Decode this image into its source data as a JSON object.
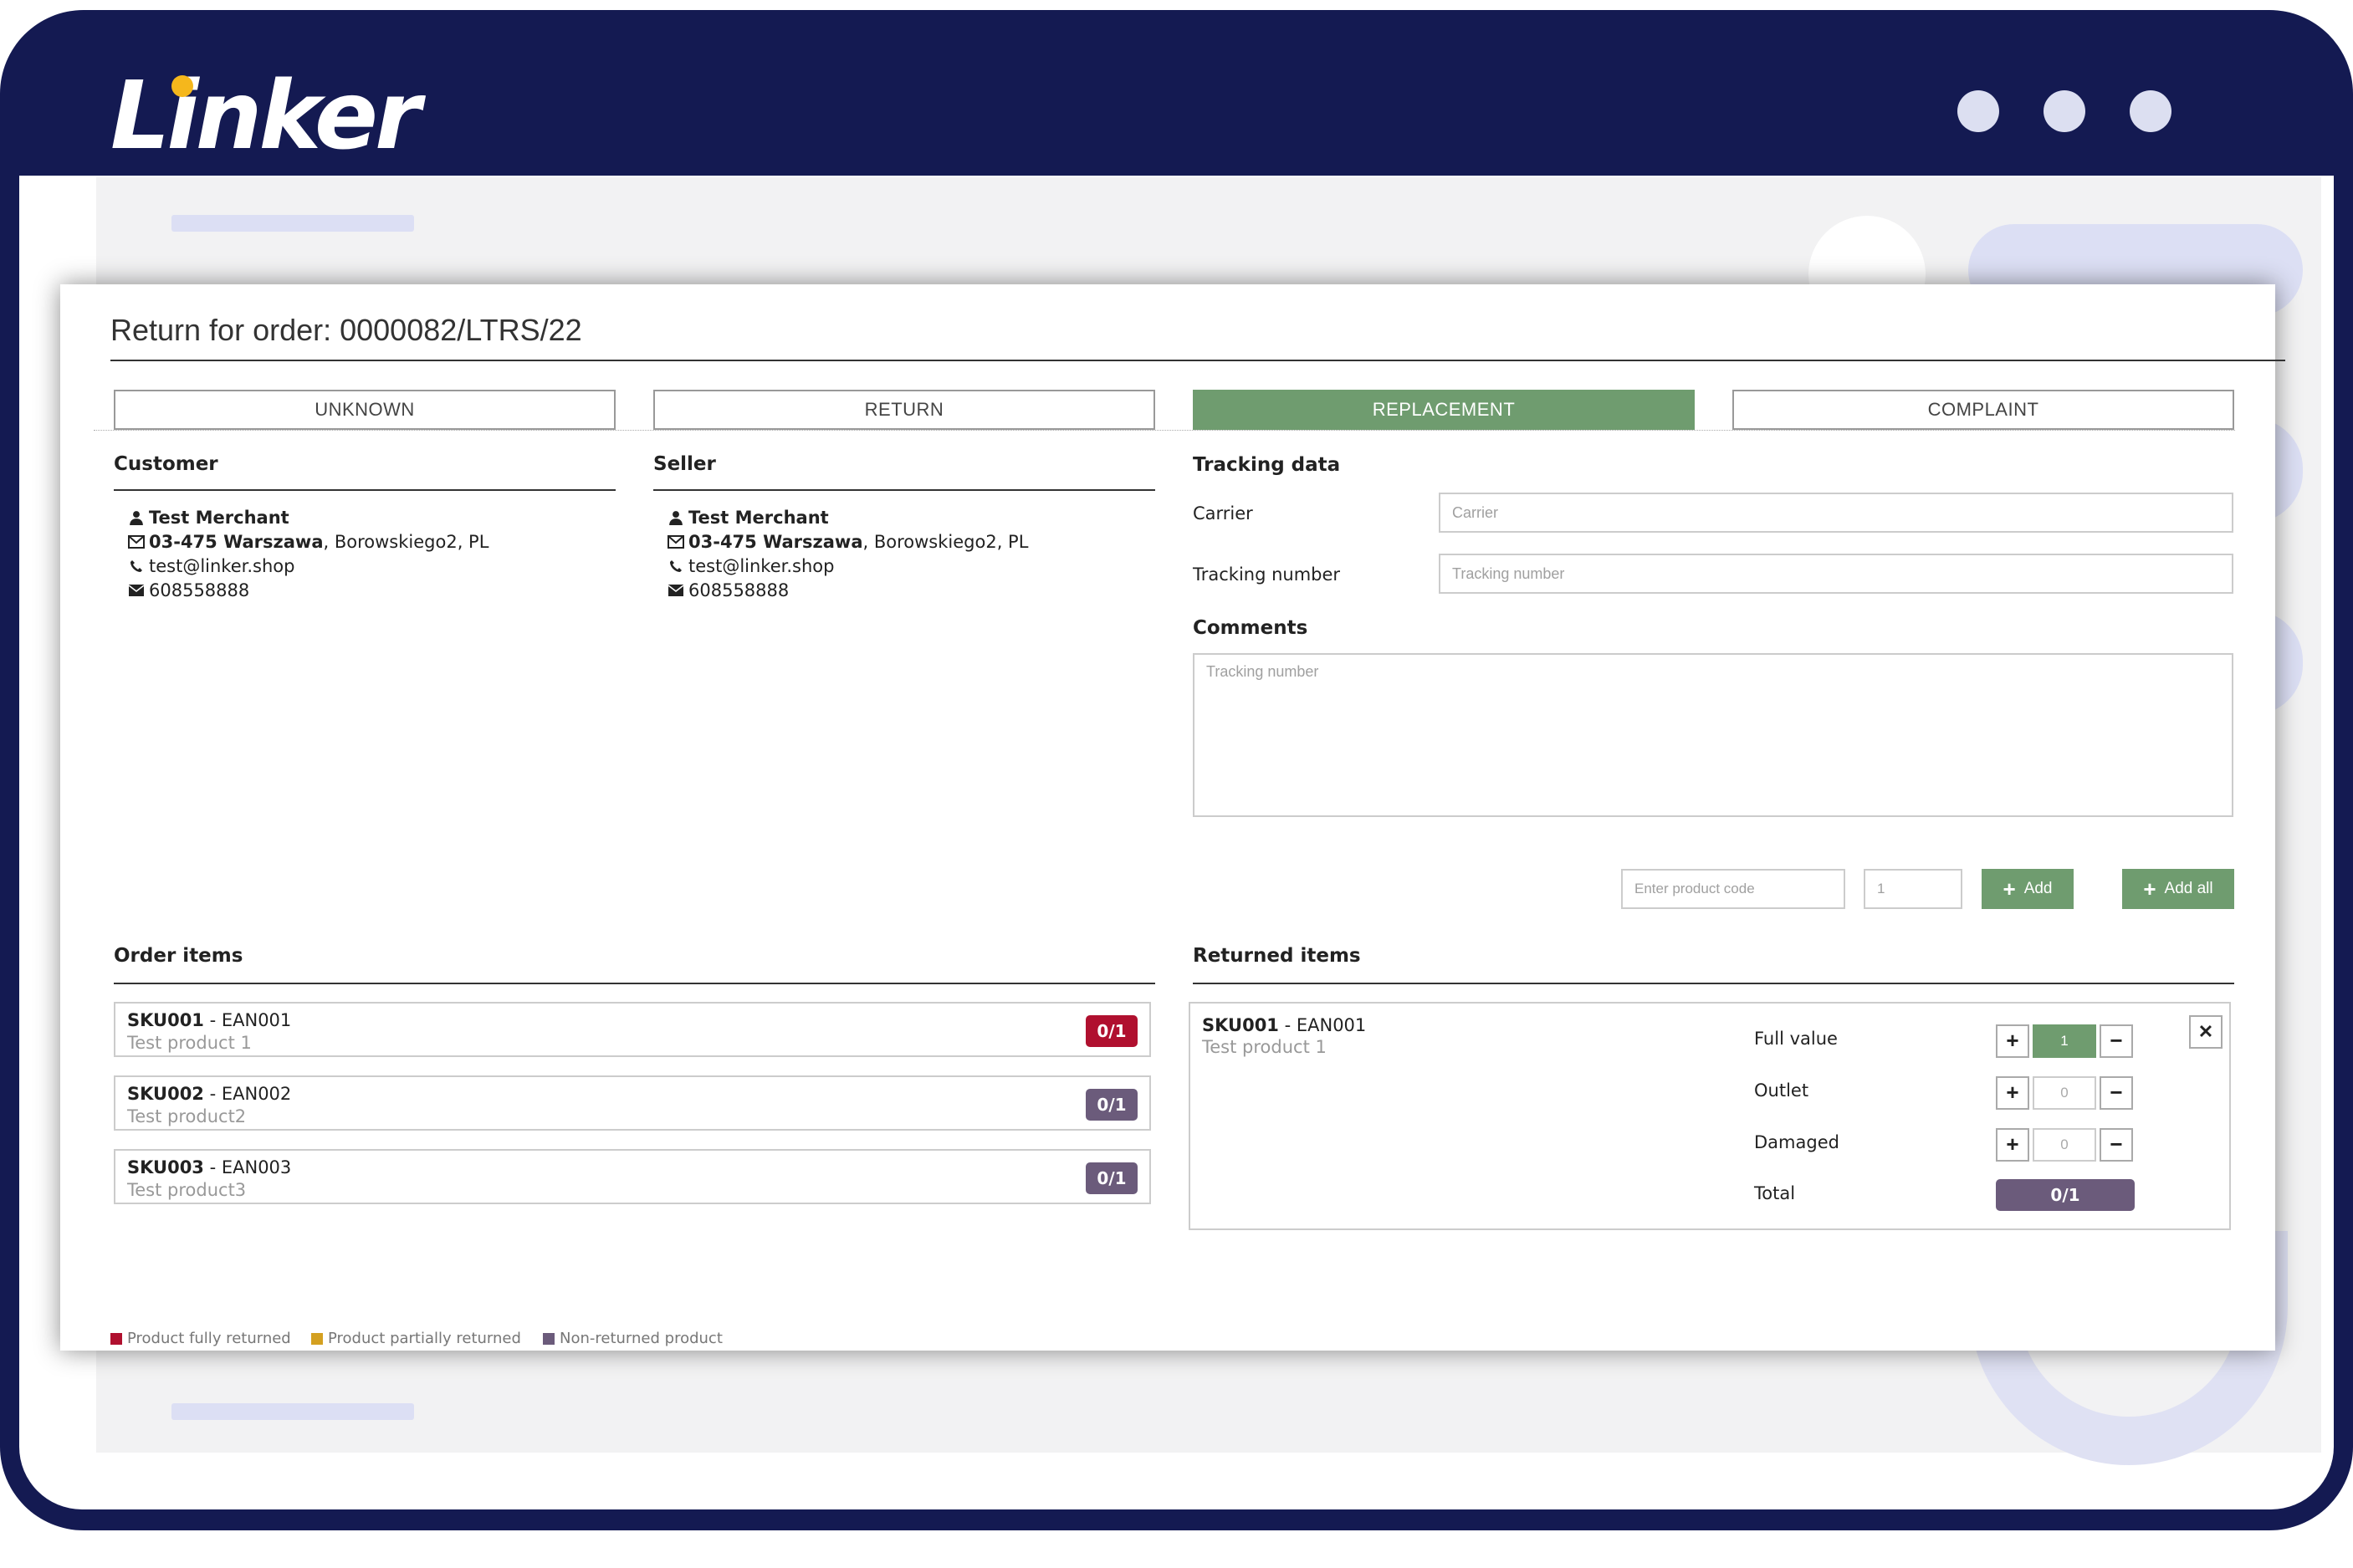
{
  "app": {
    "logo_text": "Linker"
  },
  "modal": {
    "title": "Return for order: 0000082/LTRS/22",
    "tabs": [
      {
        "label": "UNKNOWN",
        "active": false
      },
      {
        "label": "RETURN",
        "active": false
      },
      {
        "label": "REPLACEMENT",
        "active": true
      },
      {
        "label": "COMPLAINT",
        "active": false
      }
    ],
    "customer": {
      "heading": "Customer",
      "name": "Test Merchant",
      "postal_city": "03-475 Warszawa",
      "street": ", Borowskiego2, PL",
      "email": "test@linker.shop",
      "phone": "608558888"
    },
    "seller": {
      "heading": "Seller",
      "name": "Test Merchant",
      "postal_city": "03-475 Warszawa",
      "street": ", Borowskiego2, PL",
      "email": "test@linker.shop",
      "phone": "608558888"
    },
    "tracking": {
      "heading": "Tracking data",
      "carrier_label": "Carrier",
      "carrier_placeholder": "Carrier",
      "tracking_label": "Tracking number",
      "tracking_placeholder": "Tracking number",
      "comments_heading": "Comments",
      "comments_placeholder": "Tracking number"
    },
    "add_product": {
      "code_placeholder": "Enter product code",
      "qty_placeholder": "1",
      "add_label": "Add",
      "add_all_label": "Add all"
    },
    "order_items": {
      "heading": "Order items",
      "items": [
        {
          "sku": "SKU001",
          "ean": " - EAN001",
          "name": "Test product 1",
          "badge": "0/1",
          "badge_color": "#b0102f"
        },
        {
          "sku": "SKU002",
          "ean": " - EAN002",
          "name": "Test product2",
          "badge": "0/1",
          "badge_color": "#6b5b7b"
        },
        {
          "sku": "SKU003",
          "ean": " - EAN003",
          "name": "Test product3",
          "badge": "0/1",
          "badge_color": "#6b5b7b"
        }
      ]
    },
    "returned_items": {
      "heading": "Returned items",
      "item": {
        "sku": "SKU001",
        "ean": " - EAN001",
        "name": "Test product 1",
        "full_value_label": "Full value",
        "full_value": "1",
        "outlet_label": "Outlet",
        "outlet": "0",
        "damaged_label": "Damaged",
        "damaged": "0",
        "total_label": "Total",
        "total": "0/1",
        "total_color": "#6b5b7b"
      }
    },
    "legend": [
      {
        "label": "Product fully returned",
        "color": "#b0102f"
      },
      {
        "label": "Product partially returned",
        "color": "#d4a020"
      },
      {
        "label": "Non-returned product",
        "color": "#6b5b7b"
      }
    ]
  },
  "colors": {
    "frame": "#141a52",
    "accent_green": "#6f9c6f",
    "logo_dot": "#f5b71c"
  }
}
